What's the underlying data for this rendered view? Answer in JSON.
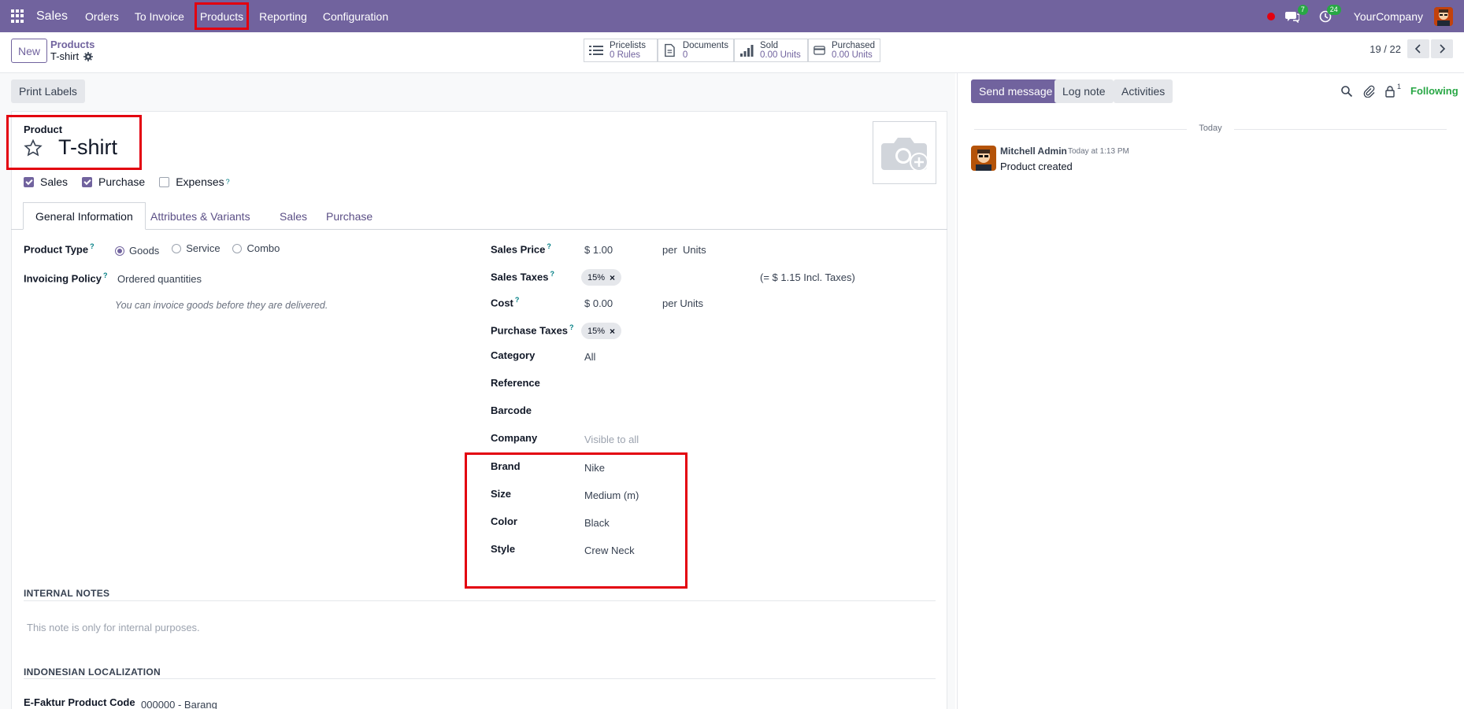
{
  "navbar": {
    "brand": "Sales",
    "menu": [
      "Orders",
      "To Invoice",
      "Products",
      "Reporting",
      "Configuration"
    ],
    "messages_count": "7",
    "activities_count": "24",
    "company": "YourCompany"
  },
  "control": {
    "new_label": "New",
    "breadcrumb_parent": "Products",
    "breadcrumb_current": "T-shirt",
    "smart_buttons": [
      {
        "label": "Pricelists",
        "value": "0 Rules"
      },
      {
        "label": "Documents",
        "value": "0"
      },
      {
        "label": "Sold",
        "value": "0.00 Units"
      },
      {
        "label": "Purchased",
        "value": "0.00 Units"
      }
    ],
    "pager": "19 / 22"
  },
  "form": {
    "print_labels": "Print Labels",
    "product_label": "Product",
    "product_name": "T-shirt",
    "checks": [
      {
        "label": "Sales",
        "checked": true
      },
      {
        "label": "Purchase",
        "checked": true
      },
      {
        "label": "Expenses",
        "checked": false
      }
    ],
    "tabs": [
      "General Information",
      "Attributes & Variants",
      "Sales",
      "Purchase"
    ],
    "product_type_label": "Product Type",
    "product_type_options": [
      "Goods",
      "Service",
      "Combo"
    ],
    "invoicing_policy_label": "Invoicing Policy",
    "invoicing_policy_value": "Ordered quantities",
    "invoicing_hint": "You can invoice goods before they are delivered.",
    "sales_price_label": "Sales Price",
    "sales_price_value": "$ 1.00",
    "sales_price_unit": "per  Units",
    "sales_taxes_label": "Sales Taxes",
    "sales_taxes_tag": "15%",
    "sales_taxes_incl": "(= $ 1.15 Incl. Taxes)",
    "cost_label": "Cost",
    "cost_value": "$ 0.00",
    "cost_unit": "per Units",
    "purchase_taxes_label": "Purchase Taxes",
    "purchase_taxes_tag": "15%",
    "category_label": "Category",
    "category_value": "All",
    "reference_label": "Reference",
    "barcode_label": "Barcode",
    "company_label": "Company",
    "company_placeholder": "Visible to all",
    "brand_label": "Brand",
    "brand_value": "Nike",
    "size_label": "Size",
    "size_value": "Medium (m)",
    "color_label": "Color",
    "color_value": "Black",
    "style_label": "Style",
    "style_value": "Crew Neck",
    "internal_notes_title": "INTERNAL NOTES",
    "internal_notes_placeholder": "This note is only for internal purposes.",
    "indonesian_title": "INDONESIAN LOCALIZATION",
    "efaktur_label": "E-Faktur Product Code",
    "efaktur_value": "000000 - Barang"
  },
  "chatter": {
    "send_message": "Send message",
    "log_note": "Log note",
    "activities": "Activities",
    "followers_count": "1",
    "following": "Following",
    "date_separator": "Today",
    "message": {
      "author": "Mitchell Admin",
      "time": "Today at 1:13 PM",
      "body": "Product created"
    }
  },
  "colors": {
    "brand": "#71639e",
    "highlight": "#e3000f",
    "success": "#28a745"
  }
}
